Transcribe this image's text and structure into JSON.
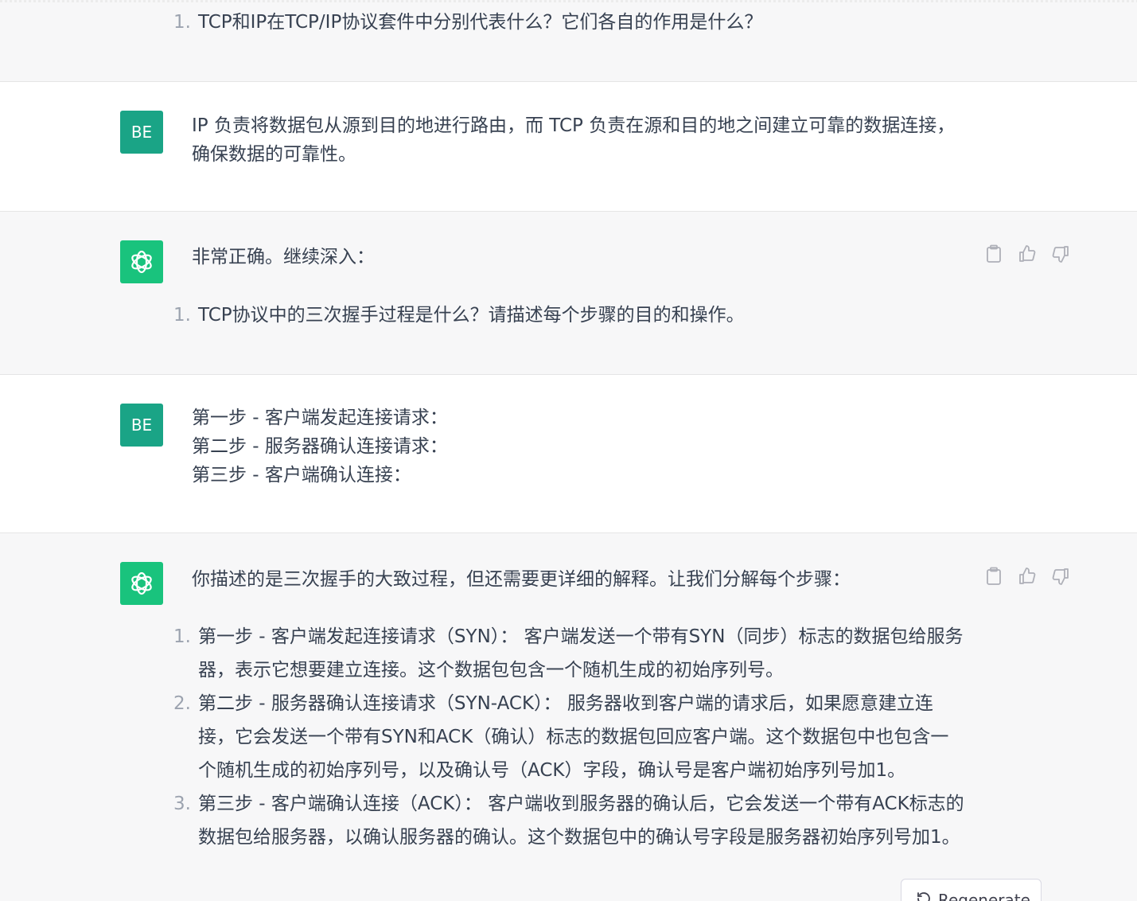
{
  "conversation": {
    "m1": {
      "items": [
        {
          "num": "1.",
          "text": "TCP和IP在TCP/IP协议套件中分别代表什么？它们各自的作用是什么？"
        }
      ]
    },
    "m2": {
      "avatar": "BE",
      "text": "IP 负责将数据包从源到目的地进行路由，而 TCP 负责在源和目的地之间建立可靠的数据连接，确保数据的可靠性。"
    },
    "m3": {
      "intro": "非常正确。继续深入：",
      "items": [
        {
          "num": "1.",
          "text": "TCP协议中的三次握手过程是什么？请描述每个步骤的目的和操作。"
        }
      ]
    },
    "m4": {
      "avatar": "BE",
      "lines": [
        "第一步 - 客户端发起连接请求：",
        "第二步 - 服务器确认连接请求：",
        "第三步 - 客户端确认连接："
      ]
    },
    "m5": {
      "intro": "你描述的是三次握手的大致过程，但还需要更详细的解释。让我们分解每个步骤：",
      "items": [
        {
          "num": "1.",
          "text": "第一步 - 客户端发起连接请求（SYN）： 客户端发送一个带有SYN（同步）标志的数据包给服务器，表示它想要建立连接。这个数据包包含一个随机生成的初始序列号。"
        },
        {
          "num": "2.",
          "text": "第二步 - 服务器确认连接请求（SYN-ACK）： 服务器收到客户端的请求后，如果愿意建立连接，它会发送一个带有SYN和ACK（确认）标志的数据包回应客户端。这个数据包中也包含一个随机生成的初始序列号，以及确认号（ACK）字段，确认号是客户端初始序列号加1。"
        },
        {
          "num": "3.",
          "text": "第三步 - 客户端确认连接（ACK）： 客户端收到服务器的确认后，它会发送一个带有ACK标志的数据包给服务器，以确认服务器的确认。这个数据包中的确认号字段是服务器初始序列号加1。"
        }
      ]
    }
  },
  "icons": {
    "copy": "clipboard-icon",
    "like": "thumbs-up-icon",
    "dislike": "thumbs-down-icon",
    "logo": "openai-logo-icon",
    "regen": "refresh-icon"
  },
  "regenerate": {
    "label": "Regenerate"
  },
  "colors": {
    "bot_avatar": "#19c37d",
    "user_avatar": "#1aa486",
    "assistant_bg": "#f7f7f8"
  }
}
